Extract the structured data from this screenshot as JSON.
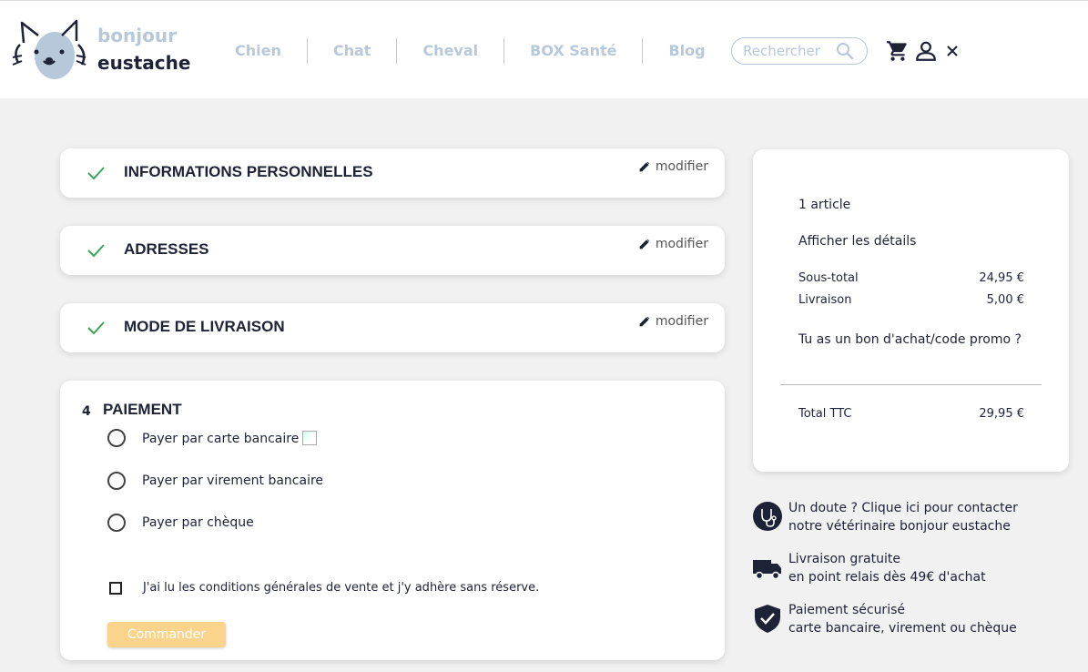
{
  "header": {
    "logo": {
      "line1": "bonjour",
      "line2": "eustache"
    },
    "nav": [
      {
        "label": "Chien"
      },
      {
        "label": "Chat"
      },
      {
        "label": "Cheval"
      },
      {
        "label": "BOX Santé"
      },
      {
        "label": "Blog"
      }
    ],
    "search": {
      "placeholder": "Rechercher",
      "value": ""
    },
    "icons": [
      "cart-icon",
      "user-icon",
      "close-icon"
    ]
  },
  "steps": [
    {
      "title": "INFORMATIONS PERSONNELLES",
      "modify": "modifier",
      "status": "complete"
    },
    {
      "title": "ADRESSES",
      "modify": "modifier",
      "status": "complete"
    },
    {
      "title": "MODE DE LIVRAISON",
      "modify": "modifier",
      "status": "complete"
    }
  ],
  "payment": {
    "number": "4",
    "title": "PAIEMENT",
    "options": [
      {
        "label": "Payer par carte bancaire"
      },
      {
        "label": "Payer par virement bancaire"
      },
      {
        "label": "Payer par chèque"
      }
    ],
    "terms": "J'ai lu les conditions générales de vente et j'y adhère sans réserve.",
    "submit": "Commander"
  },
  "summary": {
    "count": "1 article",
    "details": "Afficher les détails",
    "subtotal_label": "Sous-total",
    "subtotal_value": "24,95 €",
    "shipping_label": "Livraison",
    "shipping_value": "5,00 €",
    "promo": "Tu as un bon d'achat/code promo ?",
    "total_label": "Total TTC",
    "total_value": "29,95 €"
  },
  "info": [
    {
      "icon": "stethoscope-icon",
      "line1": "Un doute ? Clique ici pour contacter",
      "line2": "notre vétérinaire bonjour eustache"
    },
    {
      "icon": "truck-icon",
      "line1": "Livraison gratuite",
      "line2": "en point relais dès 49€ d'achat"
    },
    {
      "icon": "shield-check-icon",
      "line1": "Paiement sécurisé",
      "line2": "carte bancaire, virement ou chèque"
    }
  ],
  "colors": {
    "navy": "#1e2237",
    "light_blue": "#b7c8da",
    "check_green": "#3aa655",
    "button_disabled": "#fad48a",
    "background": "#f1f1f1"
  }
}
